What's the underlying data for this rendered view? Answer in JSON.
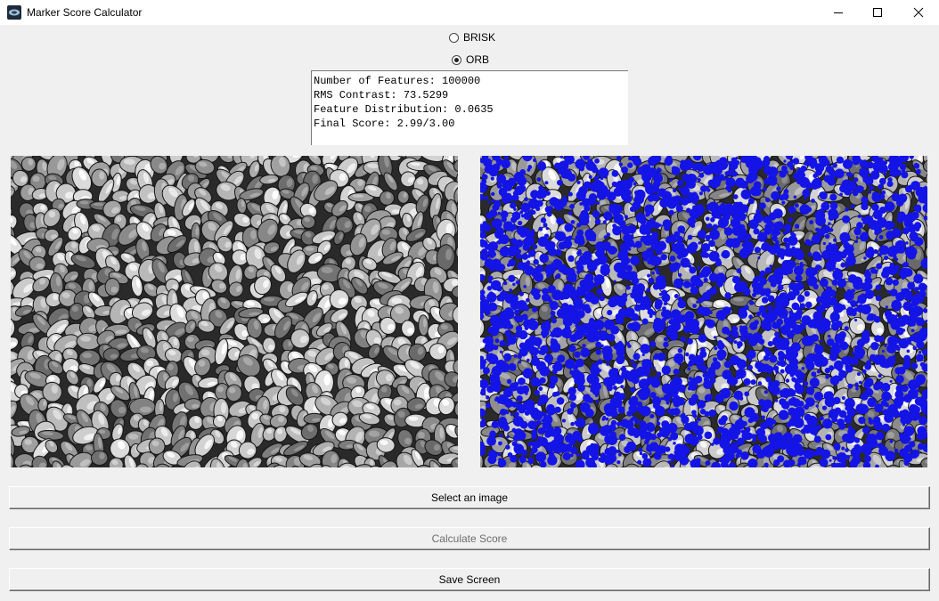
{
  "window": {
    "title": "Marker Score Calculator"
  },
  "detector": {
    "options": [
      {
        "label": "BRISK",
        "checked": false
      },
      {
        "label": "ORB",
        "checked": true
      }
    ]
  },
  "results": {
    "lines": [
      "Number of Features: 100000",
      "RMS Contrast: 73.5299",
      "Feature Distribution: 0.0635",
      "Final Score: 2.99/3.00"
    ]
  },
  "buttons": {
    "select_image": "Select an image",
    "calculate_score": "Calculate Score",
    "save_screen": "Save Screen"
  },
  "colors": {
    "feature_overlay": "#1414e6"
  }
}
